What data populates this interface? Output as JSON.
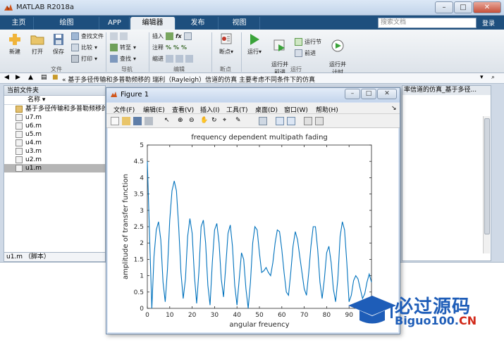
{
  "window": {
    "title": "MATLAB R2018a",
    "min": "–",
    "max": "□",
    "close": "✕"
  },
  "tabs": [
    "主页",
    "绘图",
    "APP",
    "编辑器",
    "发布",
    "视图"
  ],
  "search": {
    "placeholder": "搜索文档"
  },
  "login": "登录",
  "ribbon": {
    "file_group": {
      "new": "新建",
      "open": "打开",
      "save": "保存",
      "find_files": "查找文件",
      "compare": "比较",
      "print": "打印",
      "label": "文件"
    },
    "nav_group": {
      "goto": "转至",
      "find": "查找",
      "label": "导航"
    },
    "edit_group": {
      "insert": "插入",
      "comment": "注释",
      "indent": "缩进",
      "label": "编辑"
    },
    "breakpoint_group": {
      "breakpoints": "断点",
      "label": "断点"
    },
    "run_group": {
      "run": "运行",
      "run_advance": "运行并\n前进",
      "run_section": "运行节",
      "advance": "前进",
      "run_time": "运行并\n计时",
      "label": "运行"
    }
  },
  "address": {
    "path": "«  基于多径传输和多普勒频移的 瑞利（Rayleigh）信道的仿真 主要考虑不同条件下的仿真"
  },
  "current_folder": {
    "title": "当前文件夹",
    "column": "名称",
    "files": [
      "基于多径传输和多普勒频移的",
      "u7.m",
      "u6.m",
      "u5.m",
      "u4.m",
      "u3.m",
      "u2.m",
      "u1.m"
    ],
    "selected_index": 7,
    "details": "u1.m （脚本）"
  },
  "right_panel": {
    "header": "率信道的仿真_基于多径..."
  },
  "figure": {
    "title": "Figure 1",
    "menu": [
      "文件(F)",
      "编辑(E)",
      "查看(V)",
      "插入(I)",
      "工具(T)",
      "桌面(D)",
      "窗口(W)",
      "帮助(H)"
    ]
  },
  "chart_data": {
    "type": "line",
    "title": "frequency dependent multipath fading",
    "xlabel": "angular freuency",
    "ylabel": "amplitude of transfer function",
    "xlim": [
      0,
      100
    ],
    "ylim": [
      0,
      5
    ],
    "xticks": [
      0,
      10,
      20,
      30,
      40,
      50,
      60,
      70,
      80,
      90
    ],
    "yticks": [
      0,
      0.5,
      1,
      1.5,
      2,
      2.5,
      3,
      3.5,
      4,
      4.5,
      5
    ],
    "color": "#0072BD",
    "x": [
      0,
      1,
      2,
      3,
      4,
      5,
      6,
      7,
      8,
      9,
      10,
      11,
      12,
      13,
      14,
      15,
      16,
      17,
      18,
      19,
      20,
      21,
      22,
      23,
      24,
      25,
      26,
      27,
      28,
      29,
      30,
      31,
      32,
      33,
      34,
      35,
      36,
      37,
      38,
      39,
      40,
      41,
      42,
      43,
      44,
      45,
      46,
      47,
      48,
      49,
      50,
      51,
      52,
      53,
      54,
      55,
      56,
      57,
      58,
      59,
      60,
      61,
      62,
      63,
      64,
      65,
      66,
      67,
      68,
      69,
      70,
      71,
      72,
      73,
      74,
      75,
      76,
      77,
      78,
      79,
      80,
      81,
      82,
      83,
      84,
      85,
      86,
      87,
      88,
      89,
      90,
      91,
      92,
      93,
      94,
      95,
      96,
      97,
      98,
      99,
      100
    ],
    "y": [
      4.5,
      2.2,
      0.0,
      1.6,
      2.4,
      2.65,
      2.1,
      0.8,
      0.2,
      1.2,
      2.7,
      3.6,
      3.9,
      3.6,
      2.5,
      1.1,
      0.3,
      0.9,
      2.2,
      2.75,
      2.3,
      1.0,
      0.15,
      1.1,
      2.5,
      2.7,
      2.0,
      0.7,
      0.1,
      1.4,
      2.4,
      2.6,
      2.0,
      0.9,
      0.35,
      1.3,
      2.3,
      2.55,
      1.9,
      0.7,
      0.1,
      0.9,
      1.7,
      1.5,
      0.6,
      0.0,
      0.8,
      2.0,
      2.5,
      2.4,
      1.7,
      1.1,
      1.15,
      1.25,
      1.1,
      1.0,
      1.4,
      2.0,
      2.4,
      2.35,
      1.8,
      1.1,
      0.5,
      0.4,
      1.1,
      1.9,
      2.35,
      2.1,
      1.6,
      1.1,
      0.6,
      0.4,
      1.1,
      1.9,
      2.5,
      2.5,
      1.8,
      0.8,
      0.3,
      0.9,
      1.7,
      1.9,
      1.4,
      0.6,
      0.2,
      0.9,
      2.2,
      2.65,
      2.4,
      1.4,
      0.2,
      0.4,
      0.85,
      1.0,
      0.9,
      0.6,
      0.3,
      0.45,
      0.8,
      1.05,
      0.8
    ]
  },
  "watermark": {
    "cn": "必过源码",
    "en_prefix": "Biguo100.",
    "en_suffix": "CN"
  }
}
